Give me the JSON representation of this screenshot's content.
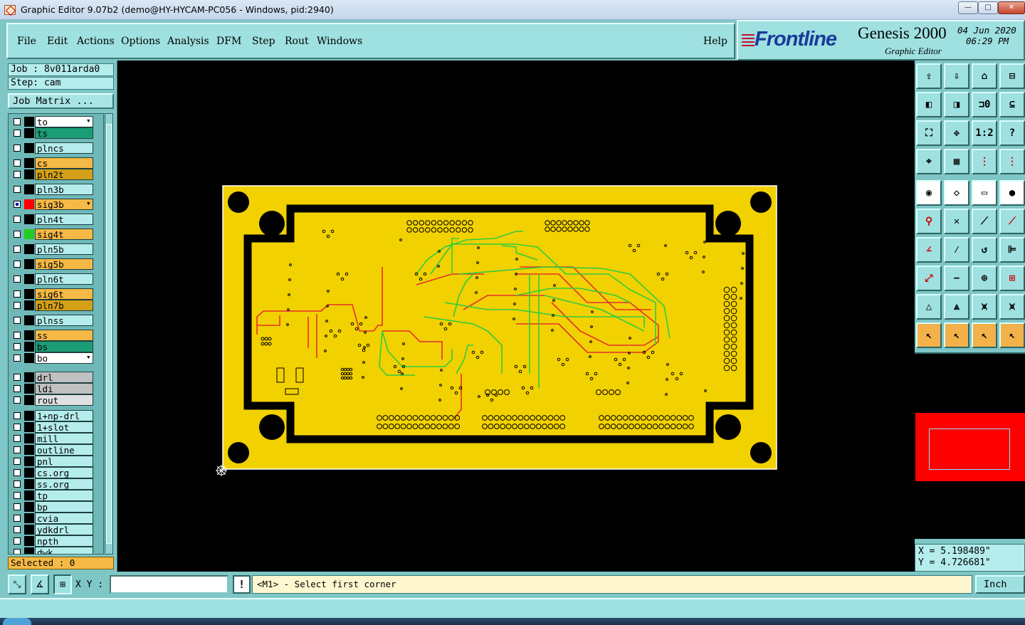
{
  "window": {
    "title": "Graphic Editor 9.07b2 (demo@HY-HYCAM-PC056 - Windows, pid:2940)",
    "min_label": "—",
    "max_label": "□",
    "close_label": "✕"
  },
  "menu": {
    "file": "File",
    "edit": "Edit",
    "actions": "Actions",
    "options": "Options",
    "analysis": "Analysis",
    "dfm": "DFM",
    "step": "Step",
    "rout": "Rout",
    "windows": "Windows",
    "help": "Help"
  },
  "brand": {
    "logo": "Frontline",
    "product": "Genesis 2000",
    "subtitle": "Graphic Editor",
    "date": "04 Jun 2020",
    "time": "06:29 PM"
  },
  "job": {
    "job": "Job : 8v011arda0",
    "step": "Step: cam",
    "matrix": "Job Matrix ..."
  },
  "layers": [
    {
      "name": "to",
      "bg": "#ffffff",
      "swatch": "#000000",
      "edit": true
    },
    {
      "name": "ts",
      "bg": "#1b9e77",
      "swatch": "#000000"
    },
    {
      "name": "plncs",
      "bg": "#b5ecec",
      "swatch": "#000000"
    },
    {
      "name": "cs",
      "bg": "#f5b945",
      "swatch": "#000000"
    },
    {
      "name": "pln2t",
      "bg": "#d4a017",
      "swatch": "#000000"
    },
    {
      "name": "pln3b",
      "bg": "#b5ecec",
      "swatch": "#000000"
    },
    {
      "name": "sig3b",
      "bg": "#f5b945",
      "swatch": "#ff0000",
      "cb": "#0000cc",
      "edit": true
    },
    {
      "name": "pln4t",
      "bg": "#b5ecec",
      "swatch": "#000000"
    },
    {
      "name": "sig4t",
      "bg": "#f5b945",
      "swatch": "#22cc22"
    },
    {
      "name": "pln5b",
      "bg": "#b5ecec",
      "swatch": "#000000"
    },
    {
      "name": "sig5b",
      "bg": "#f5b945",
      "swatch": "#000000"
    },
    {
      "name": "pln6t",
      "bg": "#b5ecec",
      "swatch": "#000000"
    },
    {
      "name": "sig6t",
      "bg": "#f5b945",
      "swatch": "#000000"
    },
    {
      "name": "pln7b",
      "bg": "#d4a017",
      "swatch": "#000000"
    },
    {
      "name": "plnss",
      "bg": "#b5ecec",
      "swatch": "#000000"
    },
    {
      "name": "ss",
      "bg": "#f5b945",
      "swatch": "#000000"
    },
    {
      "name": "bs",
      "bg": "#1b9e77",
      "swatch": "#000000"
    },
    {
      "name": "bo",
      "bg": "#ffffff",
      "swatch": "#000000",
      "edit": true
    },
    {
      "name": "drl",
      "bg": "#c0c0c0",
      "swatch": "#000000"
    },
    {
      "name": "ldi",
      "bg": "#c0c0c0",
      "swatch": "#000000"
    },
    {
      "name": "rout",
      "bg": "#e0e0e0",
      "swatch": "#000000"
    },
    {
      "name": "1+np-drl",
      "bg": "#b5ecec",
      "swatch": "#000000"
    },
    {
      "name": "1+slot",
      "bg": "#b5ecec",
      "swatch": "#000000"
    },
    {
      "name": "mill",
      "bg": "#b5ecec",
      "swatch": "#000000"
    },
    {
      "name": "outline",
      "bg": "#b5ecec",
      "swatch": "#000000"
    },
    {
      "name": "pnl",
      "bg": "#b5ecec",
      "swatch": "#000000"
    },
    {
      "name": "cs.org",
      "bg": "#b5ecec",
      "swatch": "#000000"
    },
    {
      "name": "ss.org",
      "bg": "#b5ecec",
      "swatch": "#000000"
    },
    {
      "name": "tp",
      "bg": "#b5ecec",
      "swatch": "#000000"
    },
    {
      "name": "bp",
      "bg": "#b5ecec",
      "swatch": "#000000"
    },
    {
      "name": "cvia",
      "bg": "#b5ecec",
      "swatch": "#000000"
    },
    {
      "name": "ydkdrl",
      "bg": "#b5ecec",
      "swatch": "#000000"
    },
    {
      "name": "npth",
      "bg": "#b5ecec",
      "swatch": "#000000"
    },
    {
      "name": "dwk",
      "bg": "#b5ecec",
      "swatch": "#000000"
    }
  ],
  "selected": "Selected : 0",
  "coords": {
    "x": "X = 5.198489\"",
    "y": "Y = 4.726681\""
  },
  "tools": [
    {
      "icon": "export-icon",
      "glyph": "⇪",
      "style": "cyan"
    },
    {
      "icon": "import-icon",
      "glyph": "⇩",
      "style": "cyan"
    },
    {
      "icon": "home-icon",
      "glyph": "⌂",
      "style": "cyan"
    },
    {
      "icon": "window-icon",
      "glyph": "⊟",
      "style": "cyan"
    },
    {
      "icon": "pan-left-icon",
      "glyph": "◧",
      "style": "cyan"
    },
    {
      "icon": "pan-right-icon",
      "glyph": "◨",
      "style": "cyan"
    },
    {
      "icon": "ratio-icon",
      "glyph": "⊐0",
      "style": "cyan"
    },
    {
      "icon": "snap-icon",
      "glyph": "⊆",
      "style": "cyan"
    },
    {
      "icon": "zoom-fit-icon",
      "glyph": "⛶",
      "style": "cyan"
    },
    {
      "icon": "zoom-center-icon",
      "glyph": "✥",
      "style": "cyan"
    },
    {
      "icon": "scale-1-2-icon",
      "glyph": "1:2",
      "style": "cyan"
    },
    {
      "icon": "help-icon",
      "glyph": "?",
      "style": "cyan"
    },
    {
      "icon": "measure-icon",
      "glyph": "⌖",
      "style": "cyan"
    },
    {
      "icon": "grid-icon",
      "glyph": "▦",
      "style": "cyan"
    },
    {
      "icon": "net-icon",
      "glyph": "⋮",
      "style": "cyan"
    },
    {
      "icon": "net2-icon",
      "glyph": "⋮",
      "style": "cyan"
    },
    {
      "icon": "pad-icon",
      "glyph": "◉",
      "style": "white"
    },
    {
      "icon": "surface-icon",
      "glyph": "◇",
      "style": "white"
    },
    {
      "icon": "ruler-icon",
      "glyph": "▭",
      "style": "white"
    },
    {
      "icon": "dot-icon",
      "glyph": "●",
      "style": "white"
    },
    {
      "icon": "connect-icon",
      "glyph": "⚲",
      "style": "cyan"
    },
    {
      "icon": "cross-icon",
      "glyph": "✕",
      "style": "cyan"
    },
    {
      "icon": "line-icon",
      "glyph": "⟋",
      "style": "cyan"
    },
    {
      "icon": "line2-icon",
      "glyph": "⟋",
      "style": "cyan"
    },
    {
      "icon": "arc-icon",
      "glyph": "∠",
      "style": "cyan"
    },
    {
      "icon": "slash-icon",
      "glyph": "⁄",
      "style": "cyan"
    },
    {
      "icon": "rotate-icon",
      "glyph": "↺",
      "style": "cyan"
    },
    {
      "icon": "split-icon",
      "glyph": "⊫",
      "style": "cyan"
    },
    {
      "icon": "drag-icon",
      "glyph": "⤢",
      "style": "cyan"
    },
    {
      "icon": "minus-icon",
      "glyph": "−",
      "style": "cyan"
    },
    {
      "icon": "node-icon",
      "glyph": "⊕",
      "style": "cyan"
    },
    {
      "icon": "group-icon",
      "glyph": "⊞",
      "style": "cyan"
    },
    {
      "icon": "triangle-icon",
      "glyph": "△",
      "style": "cyan"
    },
    {
      "icon": "triangle-up-icon",
      "glyph": "⩓",
      "style": "cyan"
    },
    {
      "icon": "arch-icon",
      "glyph": "⩙",
      "style": "cyan"
    },
    {
      "icon": "arch2-icon",
      "glyph": "⩙",
      "style": "cyan"
    },
    {
      "icon": "pointer-icon",
      "glyph": "↖",
      "style": "orange"
    },
    {
      "icon": "pointer-select-icon",
      "glyph": "↖",
      "style": "orange"
    },
    {
      "icon": "pointer-node-icon",
      "glyph": "↖",
      "style": "orange"
    },
    {
      "icon": "pointer-move-icon",
      "glyph": "↖",
      "style": "orange"
    }
  ],
  "bottom": {
    "xy_label": "X Y :",
    "xy_value": "",
    "warn": "!",
    "prompt": "<M1> - Select first corner",
    "units": "Inch"
  },
  "colors": {
    "board": "#f2d100",
    "copper_red": "#e4302a",
    "copper_green": "#2ecc40",
    "panel": "#7fc6c6"
  }
}
